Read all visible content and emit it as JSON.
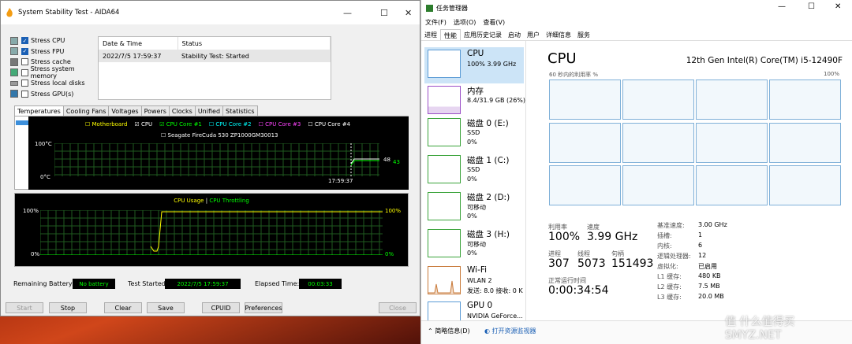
{
  "aida": {
    "title": "System Stability Test - AIDA64",
    "checks": [
      {
        "label": "Stress CPU",
        "checked": true
      },
      {
        "label": "Stress FPU",
        "checked": true
      },
      {
        "label": "Stress cache",
        "checked": false
      },
      {
        "label": "Stress system memory",
        "checked": false
      },
      {
        "label": "Stress local disks",
        "checked": false
      },
      {
        "label": "Stress GPU(s)",
        "checked": false
      }
    ],
    "log": {
      "col_date": "Date & Time",
      "col_status": "Status",
      "row_date": "2022/7/5 17:59:37",
      "row_status": "Stability Test: Started"
    },
    "tabs": [
      "Temperatures",
      "Cooling Fans",
      "Voltages",
      "Powers",
      "Clocks",
      "Unified",
      "Statistics"
    ],
    "temp_graph": {
      "legend": [
        {
          "label": "Motherboard",
          "color": "#ffff00",
          "checked": false
        },
        {
          "label": "CPU",
          "color": "#ffffff",
          "checked": true
        },
        {
          "label": "CPU Core #1",
          "color": "#00ff00",
          "checked": true
        },
        {
          "label": "CPU Core #2",
          "color": "#00ffff",
          "checked": false
        },
        {
          "label": "CPU Core #3",
          "color": "#ff44ff",
          "checked": false
        },
        {
          "label": "CPU Core #4",
          "color": "#ffffff",
          "checked": false
        },
        {
          "label": "Seagate FireCuda 530 ZP1000GM30013",
          "color": "#ffffff",
          "checked": false
        }
      ],
      "ymax": "100°C",
      "ymin": "0°C",
      "time": "17:59:37",
      "val1": "48",
      "val2": "43"
    },
    "usage_graph": {
      "title_a": "CPU Usage",
      "sep": "|",
      "title_b": "CPU Throttling",
      "ymax": "100%",
      "ymin": "0%",
      "ymax_r": "100%",
      "ymin_r": "0%"
    },
    "status": {
      "battery_label": "Remaining Battery:",
      "battery": "No battery",
      "started_label": "Test Started:",
      "started": "2022/7/5 17:59:37",
      "elapsed_label": "Elapsed Time:",
      "elapsed": "00:03:33"
    },
    "buttons": {
      "start": "Start",
      "stop": "Stop",
      "clear": "Clear",
      "save": "Save",
      "cpuid": "CPUID",
      "prefs": "Preferences",
      "close": "Close"
    }
  },
  "tm": {
    "title": "任务管理器",
    "menu": [
      "文件(F)",
      "选项(O)",
      "查看(V)"
    ],
    "tabs": [
      "进程",
      "性能",
      "应用历史记录",
      "启动",
      "用户",
      "详细信息",
      "服务"
    ],
    "side": [
      {
        "name": "CPU",
        "s1": "100% 3.99 GHz",
        "s2": ""
      },
      {
        "name": "内存",
        "s1": "8.4/31.9 GB (26%)",
        "s2": ""
      },
      {
        "name": "磁盘 0 (E:)",
        "s1": "SSD",
        "s2": "0%"
      },
      {
        "name": "磁盘 1 (C:)",
        "s1": "SSD",
        "s2": "0%"
      },
      {
        "name": "磁盘 2 (D:)",
        "s1": "可移动",
        "s2": "0%"
      },
      {
        "name": "磁盘 3 (H:)",
        "s1": "可移动",
        "s2": "0%"
      },
      {
        "name": "Wi-Fi",
        "s1": "WLAN 2",
        "s2": "发送: 8.0  接收: 0 K"
      },
      {
        "name": "GPU 0",
        "s1": "NVIDIA GeForce...",
        "s2": ""
      }
    ],
    "main": {
      "title": "CPU",
      "model": "12th Gen Intel(R) Core(TM) i5-12490F",
      "graph_label": "60 秒内的利用率 %",
      "graph_max": "100%",
      "util_label": "利用率",
      "util": "100%",
      "speed_label": "速度",
      "speed": "3.99 GHz",
      "proc_label": "进程",
      "proc": "307",
      "thr_label": "线程",
      "thr": "5073",
      "hnd_label": "句柄",
      "hnd": "151493",
      "up_label": "正常运行时间",
      "up": "0:00:34:54",
      "details": [
        {
          "k": "基准速度:",
          "v": "3.00 GHz"
        },
        {
          "k": "插槽:",
          "v": "1"
        },
        {
          "k": "内核:",
          "v": "6"
        },
        {
          "k": "逻辑处理器:",
          "v": "12"
        },
        {
          "k": "虚拟化:",
          "v": "已启用"
        },
        {
          "k": "L1 缓存:",
          "v": "480 KB"
        },
        {
          "k": "L2 缓存:",
          "v": "7.5 MB"
        },
        {
          "k": "L3 缓存:",
          "v": "20.0 MB"
        }
      ]
    },
    "footer": {
      "summary": "简略信息(D)",
      "monitor": "打开资源监视器"
    }
  },
  "watermark": "值 什么值得买  SMYZ.NET"
}
